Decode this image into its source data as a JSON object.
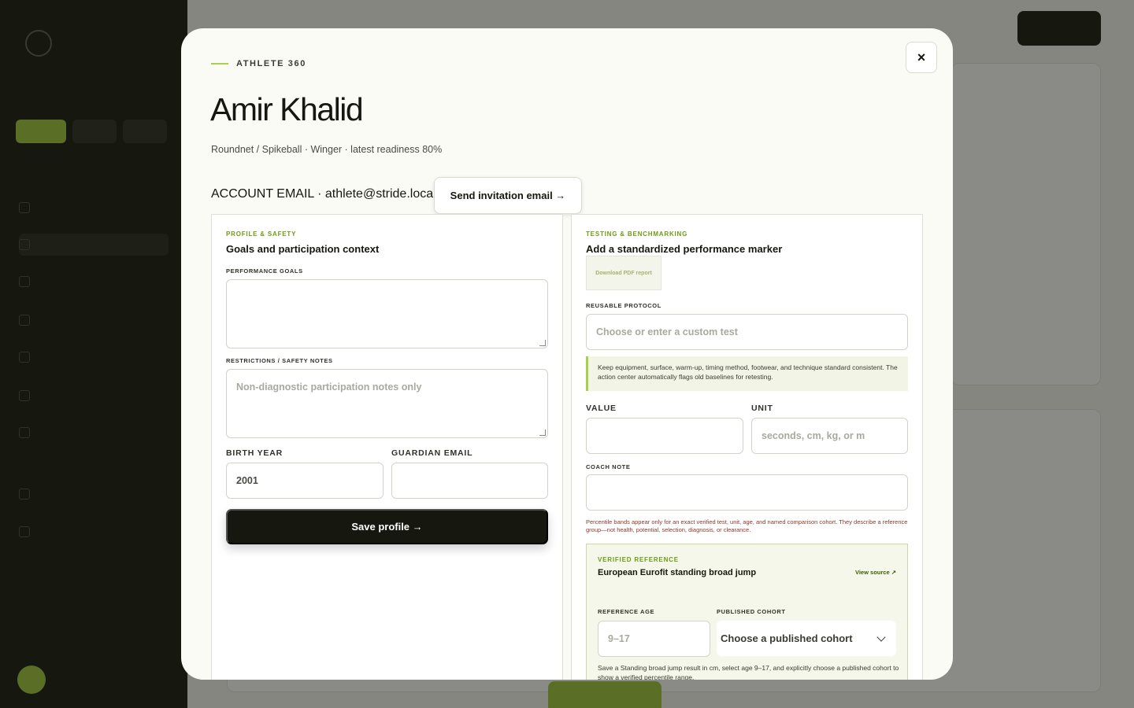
{
  "modal": {
    "eyebrow": "ATHLETE 360",
    "close_label": "×",
    "athlete_name": "Amir Khalid",
    "athlete_subtitle": "Roundnet / Spikeball · Winger · latest readiness 80%",
    "account_email_text": "ACCOUNT EMAIL · athlete@stride.local",
    "invite_button_label": "Send invitation email →"
  },
  "profile_panel": {
    "eyebrow": "PROFILE & SAFETY",
    "title": "Goals and participation context",
    "goals_label": "PERFORMANCE GOALS",
    "goals_value": "",
    "restrictions_label": "RESTRICTIONS / SAFETY NOTES",
    "restrictions_placeholder": "Non-diagnostic participation notes only",
    "birth_year_label": "BIRTH YEAR",
    "birth_year_value": "2001",
    "guardian_email_label": "GUARDIAN EMAIL",
    "guardian_email_value": "",
    "save_button_label": "Save profile →"
  },
  "testing_panel": {
    "eyebrow": "TESTING & BENCHMARKING",
    "title": "Add a standardized performance marker",
    "pdf_button_label": "Download PDF report",
    "protocol_label": "REUSABLE PROTOCOL",
    "protocol_placeholder": "Choose or enter a custom test",
    "tip_text": "Keep equipment, surface, warm-up, timing method, footwear, and technique standard consistent. The action center automatically flags old baselines for retesting.",
    "value_label": "VALUE",
    "value_value": "",
    "unit_label": "UNIT",
    "unit_placeholder": "seconds, cm, kg, or m",
    "coach_note_label": "COACH NOTE",
    "coach_note_value": "",
    "disclaimer": "Percentile bands appear only for an exact verified test, unit, age, and named comparison cohort. They describe a reference group—not health, potential, selection, diagnosis, or clearance.",
    "reference": {
      "eyebrow": "VERIFIED REFERENCE",
      "title": "European Eurofit standing broad jump",
      "view_source_label": "View source ↗",
      "age_label": "REFERENCE AGE",
      "age_placeholder": "9–17",
      "cohort_label": "PUBLISHED COHORT",
      "cohort_selected": "Choose a published cohort",
      "note": "Save a Standing broad jump result in cm, select age 9–17, and explicitly choose a published cohort to show a verified percentile range."
    }
  },
  "colors": {
    "accent": "#a9d04a",
    "eyebrow_green": "#6e9a18",
    "primary_dark": "#16180f",
    "disclaimer_red": "#8a3a2a"
  },
  "icons": {
    "close": "close-icon",
    "chevron": "chevron-down-icon"
  }
}
